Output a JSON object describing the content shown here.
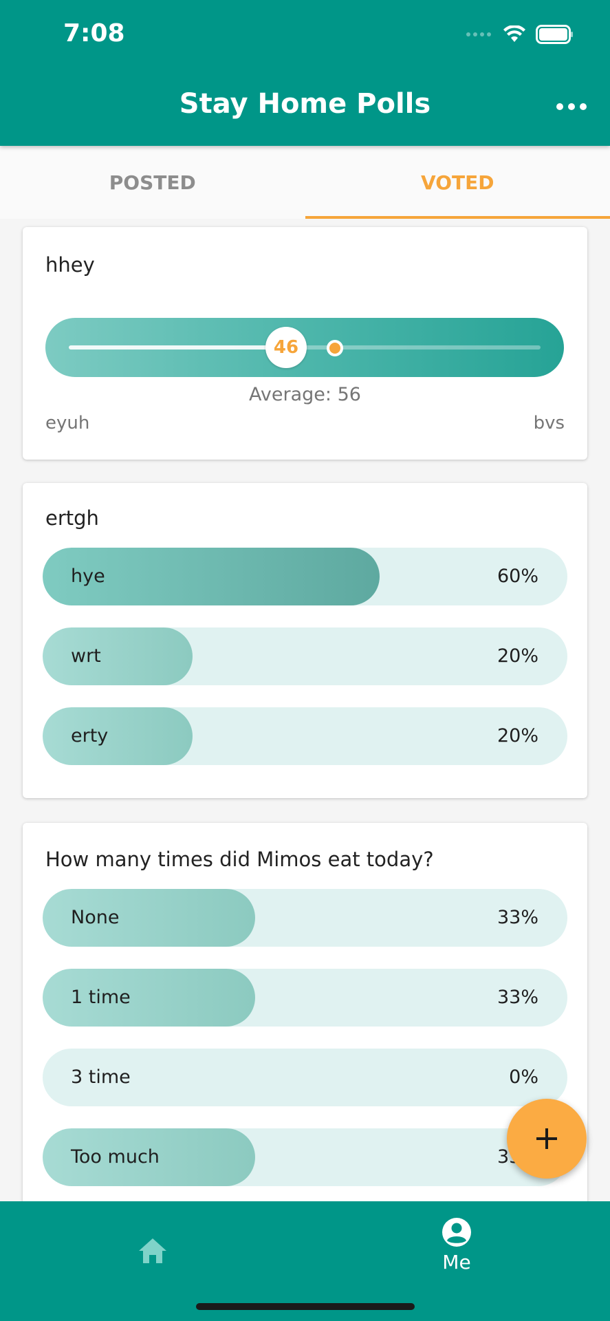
{
  "status_bar": {
    "time": "7:08"
  },
  "header": {
    "title": "Stay Home Polls",
    "more_icon": "more-horizontal-icon"
  },
  "tabs": [
    {
      "label": "POSTED",
      "active": false
    },
    {
      "label": "VOTED",
      "active": true
    }
  ],
  "polls": [
    {
      "type": "slider",
      "question": "hhey",
      "user_value": "46",
      "average_text": "Average: 56",
      "min_label": "eyuh",
      "max_label": "bvs"
    },
    {
      "type": "choice",
      "question": "ertgh",
      "options": [
        {
          "label": "hye",
          "percent": "60%",
          "fraction": 0.6
        },
        {
          "label": "wrt",
          "percent": "20%",
          "fraction": 0.2
        },
        {
          "label": "erty",
          "percent": "20%",
          "fraction": 0.2
        }
      ]
    },
    {
      "type": "choice",
      "question": "How many times did Mimos eat today?",
      "options": [
        {
          "label": "None",
          "percent": "33%",
          "fraction": 0.33
        },
        {
          "label": "1 time",
          "percent": "33%",
          "fraction": 0.33
        },
        {
          "label": "3 time",
          "percent": "0%",
          "fraction": 0
        },
        {
          "label": "Too much",
          "percent": "33%",
          "fraction": 0.33
        }
      ]
    }
  ],
  "bottom_nav": {
    "me_label": "Me"
  },
  "colors": {
    "primary": "#009688",
    "accent": "#f6a53a",
    "fab": "#fbab43"
  }
}
